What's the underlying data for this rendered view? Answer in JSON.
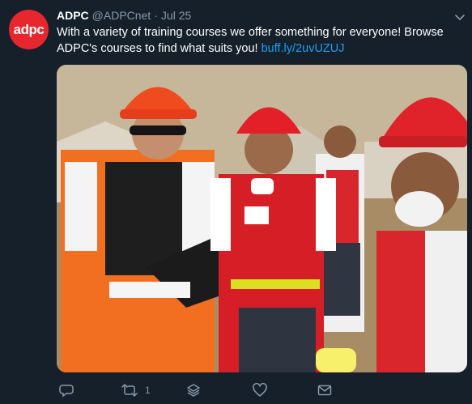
{
  "tweet": {
    "avatar_text": "adpc",
    "display_name": "ADPC",
    "handle": "@ADPCnet",
    "separator": "·",
    "date": "Jul 25",
    "text": "With a variety of training courses we offer something for everyone! Browse ADPC's courses to find what suits you! ",
    "link": "buff.ly/2uvUZUJ"
  },
  "actions": {
    "reply_count": "",
    "retweet_count": "1",
    "like_count": ""
  },
  "colors": {
    "background": "#15202b",
    "accent_link": "#1da1f2",
    "muted": "#8899a6",
    "avatar_brand": "#e8262d"
  },
  "icons": {
    "reply": "reply-icon",
    "retweet": "retweet-icon",
    "stack": "stack-icon",
    "like": "heart-icon",
    "dm": "envelope-icon",
    "caret": "chevron-down-icon"
  }
}
